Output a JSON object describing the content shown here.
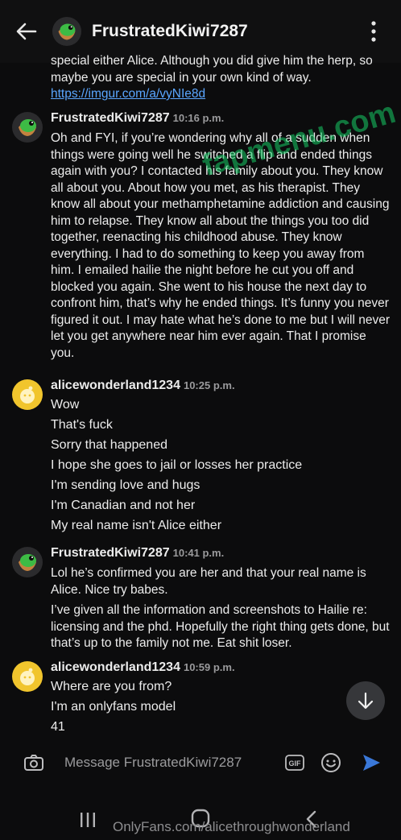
{
  "header": {
    "title": "FrustratedKiwi7287",
    "back_icon": "arrow-left-icon",
    "menu_icon": "more-vertical-icon"
  },
  "messages": {
    "m0": {
      "paragraphs": [
        {
          "text": "special either Alice. Although you did give him the herp, so maybe you are special in your own kind of way.",
          "link": "https://imgur.com/a/vyNIe8d"
        }
      ]
    },
    "m1": {
      "user": "FrustratedKiwi7287",
      "time": "10:16 p.m.",
      "text": "Oh and FYI, if you’re wondering why all of a sudden when things were going well he switched a flip and ended things again with you? I contacted his family about you. They know all about you. About how you met, as his therapist. They know all about your methamphetamine addiction and causing him to relapse. They know all about the things you too did together, reenacting his childhood abuse. They know everything. I had to do something to keep you away from him. I emailed hailie the night before he cut you off and blocked you again. She went to his house the next day to confront him, that’s why he ended things. It’s funny you never figured it out. I may hate what he’s done to me but I will never let you get anywhere near him ever again. That I promise you."
    },
    "m2": {
      "user": "alicewonderland1234",
      "time": "10:25 p.m.",
      "lines": [
        "Wow",
        "That's fuck",
        "Sorry that happened",
        "I hope she goes to jail or losses her practice",
        "I'm sending love and hugs",
        "I'm Canadian and not her",
        "My real name isn't Alice either"
      ]
    },
    "m3": {
      "user": "FrustratedKiwi7287",
      "time": "10:41 p.m.",
      "paragraphs": [
        "Lol he’s confirmed you are her and that your real name is Alice. Nice try babes.",
        "I’ve given all the information and screenshots to Hailie re: licensing and the phd. Hopefully the right thing gets done, but that’s up to the family not me. Eat shit loser."
      ]
    },
    "m4": {
      "user": "alicewonderland1234",
      "time": "10:59 p.m.",
      "lines": [
        "Where are you from?",
        "I'm an onlyfans model",
        "41"
      ]
    }
  },
  "composer": {
    "placeholder": "Message FrustratedKiwi7287",
    "icons": [
      "camera-icon",
      "gif-icon",
      "emoji-icon",
      "send-icon"
    ]
  },
  "scroll_button_icon": "arrow-down-icon",
  "watermarks": {
    "diagonal": "fapmenu.com",
    "bottom": "OnlyFans.com/alicethroughwonderland"
  },
  "colors": {
    "background": "#0c0c0d",
    "link": "#5aa6ff",
    "watermark_green": "#16cc66",
    "send": "#3a78d8"
  }
}
